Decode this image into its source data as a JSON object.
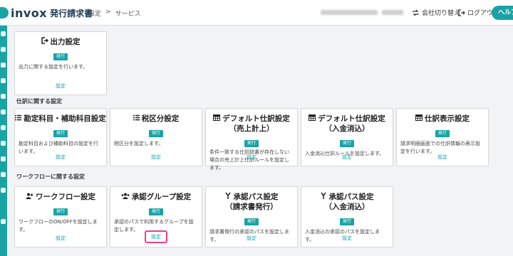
{
  "header": {
    "logo_word": "invox",
    "logo_sub": "発行請求書",
    "breadcrumb": [
      "設定",
      ">",
      "サービス"
    ],
    "switch_company": "会社切り替え",
    "logout": "ログアウト",
    "help": "ヘルプ"
  },
  "top_card": {
    "title": "出力設定",
    "badge": "発行",
    "desc": "出力に関する設定を行います。",
    "link": "設定"
  },
  "sections": {
    "journal": "仕訳に関する設定",
    "workflow": "ワークフローに関する設定"
  },
  "journal_cards": [
    {
      "title": "勘定科目・補助科目設定",
      "badge": "発行",
      "desc": "勘定科目および補助科目の設定を行います。",
      "link": "設定"
    },
    {
      "title": "税区分設定",
      "badge": "発行",
      "desc": "税区分を設定します。",
      "link": "設定"
    },
    {
      "title": "デフォルト仕訳設定",
      "title2": "（売上計上）",
      "badge": "発行",
      "desc": "条件一致する仕訳辞書が存在しない場合の売上計上仕訳ルールを設定します。",
      "link": "設定"
    },
    {
      "title": "デフォルト仕訳設定",
      "title2": "（入金消込）",
      "badge": "発行",
      "desc": "入金消込仕訳ルールを設定します。",
      "link": "設定"
    },
    {
      "title": "仕訳表示設定",
      "badge": "発行",
      "desc": "請求明細画面での仕訳情報の表示設定を行います。",
      "link": "設定"
    }
  ],
  "workflow_cards": [
    {
      "title": "ワークフロー設定",
      "badge": "発行",
      "desc": "ワークフローのON/OFFを設定します。",
      "link": "設定"
    },
    {
      "title": "承認グループ設定",
      "badge": "発行",
      "desc": "承認のパスで利用するグループを設定します。",
      "link": "設定"
    },
    {
      "title": "承認パス設定",
      "title2": "（請求書発行）",
      "badge": "発行",
      "desc": "請求書発行の承認のパスを設定します。",
      "link": "設定"
    },
    {
      "title": "承認パス設定",
      "title2": "（入金消込）",
      "badge": "発行",
      "desc": "入金消込の承認のパスを設定します。",
      "link": "設定"
    }
  ],
  "icons": {
    "output": "export-icon",
    "account": "list-icon",
    "table": "table-icon",
    "users": "users-icon",
    "route": "route-icon"
  },
  "colors": {
    "accent": "#1aa3a5",
    "highlight": "#e8418a"
  }
}
